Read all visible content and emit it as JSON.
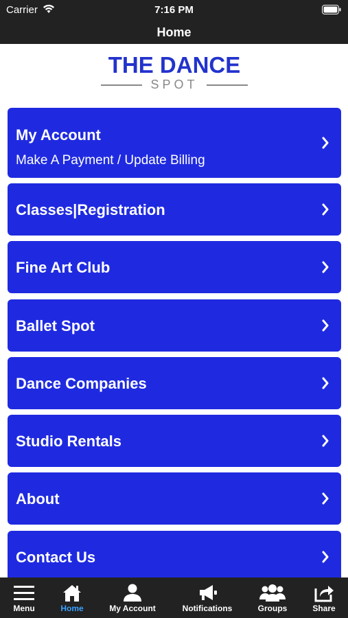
{
  "status": {
    "carrier": "Carrier",
    "time": "7:16 PM"
  },
  "nav": {
    "title": "Home"
  },
  "logo": {
    "main": "THE DANCE",
    "sub": "SPOT"
  },
  "menu": [
    {
      "label": "My Account",
      "sublabel": "Make A Payment / Update Billing"
    },
    {
      "label": "Classes|Registration"
    },
    {
      "label": "Fine Art Club"
    },
    {
      "label": "Ballet Spot"
    },
    {
      "label": "Dance Companies"
    },
    {
      "label": "Studio Rentals"
    },
    {
      "label": "About"
    },
    {
      "label": "Contact Us"
    }
  ],
  "tabs": [
    {
      "label": "Menu",
      "icon": "hamburger-icon"
    },
    {
      "label": "Home",
      "icon": "home-icon",
      "active": true
    },
    {
      "label": "My Account",
      "icon": "person-icon"
    },
    {
      "label": "Notifications",
      "icon": "megaphone-icon"
    },
    {
      "label": "Groups",
      "icon": "group-icon"
    },
    {
      "label": "Share",
      "icon": "share-icon"
    }
  ],
  "colors": {
    "button_blue": "#1f2ae0",
    "bar_dark": "#222222",
    "active_tab": "#3aa0ff",
    "logo_blue": "#2233cc"
  }
}
